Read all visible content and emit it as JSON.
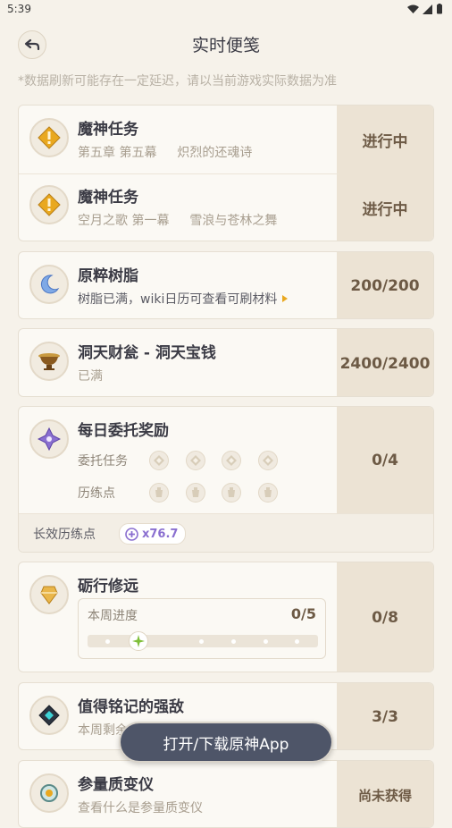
{
  "status_bar": {
    "time": "5:39"
  },
  "header": {
    "title": "实时便笺"
  },
  "notice": "*数据刷新可能存在一定延迟，请以当前游戏实际数据为准",
  "quests": {
    "items": [
      {
        "title": "魔神任务",
        "chapter": "第五章 第五幕",
        "name": "炽烈的还魂诗",
        "status": "进行中"
      },
      {
        "title": "魔神任务",
        "chapter": "空月之歌 第一幕",
        "name": "雪浪与苍林之舞",
        "status": "进行中"
      }
    ]
  },
  "resin": {
    "title": "原粹树脂",
    "desc": "树脂已满，wiki日历可查看可刷材料",
    "value": "200/200"
  },
  "realm": {
    "title": "洞天财瓮 - 洞天宝钱",
    "desc": "已满",
    "value": "2400/2400"
  },
  "commissions": {
    "title": "每日委托奖励",
    "tasks_label": "委托任务",
    "points_label": "历练点",
    "value": "0/4",
    "bonus_label": "长效历练点",
    "bonus_value": "x76.7"
  },
  "weekly": {
    "title": "砺行修远",
    "progress_label": "本周进度",
    "progress_value": "0/5",
    "value": "0/8",
    "progress_fraction": 0
  },
  "boss": {
    "title": "值得铭记的强敌",
    "desc": "本周剩余",
    "value": "3/3"
  },
  "transformer": {
    "title": "参量质变仪",
    "desc": "查看什么是参量质变仪",
    "value": "尚未获得"
  },
  "toast": "打开/下载原神App",
  "colors": {
    "accent_gold": "#e9a81f",
    "accent_purple": "#8a6fd0",
    "panel": "#ece3d4"
  }
}
